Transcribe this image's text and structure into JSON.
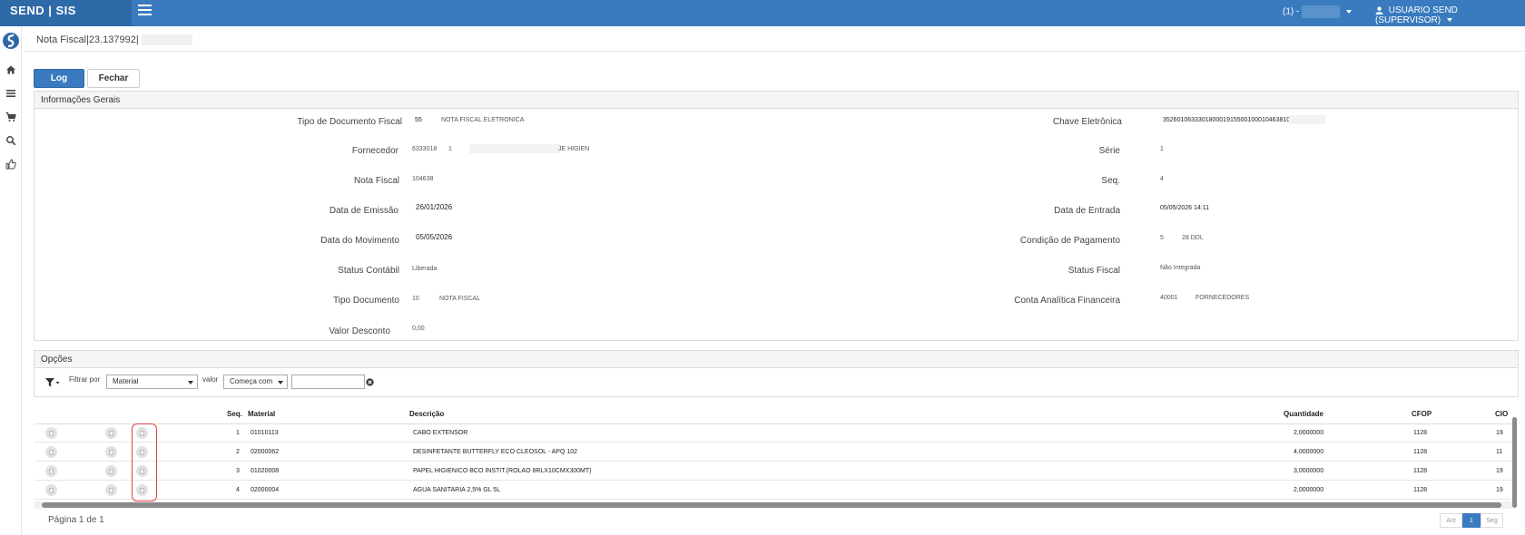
{
  "app": {
    "brand": "SEND | SIS",
    "environment": "(1) -",
    "user": "USUARIO SEND (SUPERVISOR)"
  },
  "breadcrumb": "Nota Fiscal|23.137992|",
  "buttons": {
    "log": "Log",
    "fechar": "Fechar"
  },
  "general": {
    "title": "Informações Gerais",
    "fields": {
      "tipo_doc_fiscal": {
        "label": "Tipo de Documento Fiscal",
        "code": "55",
        "desc": "NOTA FISCAL ELETRONICA"
      },
      "fornecedor": {
        "label": "Fornecedor",
        "code": "6333018",
        "sub": "1",
        "desc": "JE HIGIEN"
      },
      "nota_fiscal": {
        "label": "Nota Fiscal",
        "value": "104638"
      },
      "data_emissao": {
        "label": "Data de Emissão",
        "value": "26/01/2026"
      },
      "data_movimento": {
        "label": "Data do Movimento",
        "value": "05/05/2026"
      },
      "status_contabil": {
        "label": "Status Contábil",
        "value": "Liberada"
      },
      "tipo_documento": {
        "label": "Tipo Documento",
        "code": "10",
        "desc": "NOTA FISCAL"
      },
      "valor_desconto": {
        "label": "Valor Desconto",
        "value": "0,00"
      },
      "chave_eletronica": {
        "label": "Chave Eletrônica",
        "value": "35260106333018000191550010001046381000"
      },
      "serie": {
        "label": "Série",
        "value": "1"
      },
      "seq": {
        "label": "Seq.",
        "value": "4"
      },
      "data_entrada": {
        "label": "Data de Entrada",
        "value": "05/05/2026 14:11"
      },
      "condicao_pagamento": {
        "label": "Condição de Pagamento",
        "code": "5",
        "desc": "28 DDL"
      },
      "status_fiscal": {
        "label": "Status Fiscal",
        "value": "Não Integrada"
      },
      "conta_analitica": {
        "label": "Conta Analítica Financeira",
        "code": "40001",
        "desc": "FORNECEDORES"
      }
    }
  },
  "opcoes": {
    "title": "Opções",
    "filter_label": "Filtrar por",
    "filter_field": "Material",
    "valor_label": "valor",
    "operator": "Começa com",
    "value": ""
  },
  "table": {
    "headers": {
      "seq": "Seq.",
      "material": "Material",
      "descricao": "Descrição",
      "quantidade": "Quantidade",
      "cfop": "CFOP",
      "cio": "CIO"
    },
    "rows": [
      {
        "seq": "1",
        "material": "01010113",
        "descricao": "CABO EXTENSOR",
        "quantidade": "2,0000000",
        "cfop": "1128",
        "cio": "19"
      },
      {
        "seq": "2",
        "material": "02000062",
        "descricao": "DESINFETANTE BUTTERFLY ECO CLEOSOL - APQ 102",
        "quantidade": "4,0000000",
        "cfop": "1128",
        "cio": "11"
      },
      {
        "seq": "3",
        "material": "01020008",
        "descricao": "PAPEL HIGIENICO BCO INSTIT.(ROLAO 8RLX10CMX300MT)",
        "quantidade": "3,0000000",
        "cfop": "1128",
        "cio": "19"
      },
      {
        "seq": "4",
        "material": "02000004",
        "descricao": "AGUA SANITARIA 2,5% GL 5L",
        "quantidade": "2,0000000",
        "cfop": "1128",
        "cio": "19"
      }
    ]
  },
  "pagination": {
    "label": "Página 1 de 1",
    "prev": "Ant",
    "current": "1",
    "next": "Seg"
  },
  "colors": {
    "primary": "#3a7bbf",
    "primary_dark": "#2e69a8",
    "highlight": "#e04040"
  },
  "icons": [
    "menu-icon",
    "user-icon",
    "home-icon",
    "list-icon",
    "cart-icon",
    "search-icon",
    "thumbs-up-icon",
    "filter-icon",
    "clear-icon",
    "document-icon"
  ]
}
